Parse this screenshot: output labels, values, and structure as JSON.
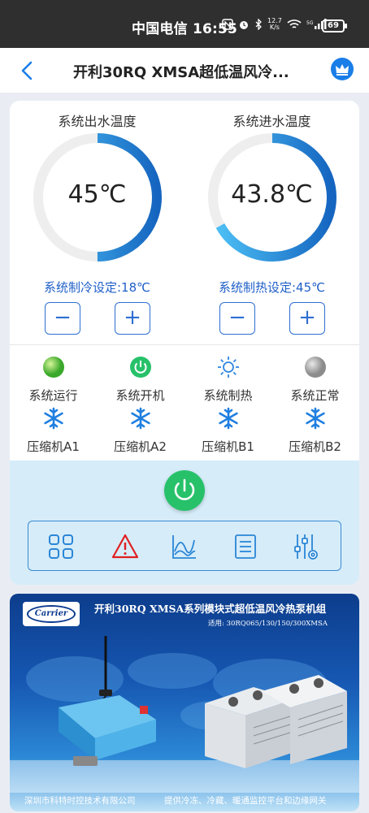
{
  "status_bar": {
    "carrier": "中国电信",
    "time": "16:55",
    "net_speed": "12.7",
    "net_unit": "K/s",
    "battery": "69"
  },
  "header": {
    "title": "开利30RQ XMSA超低温风冷..."
  },
  "gauges": [
    {
      "label": "系统出水温度",
      "value": "45℃",
      "fill": 0.5,
      "setting": "系统制冷设定:18℃",
      "minus": "−",
      "plus": "+"
    },
    {
      "label": "系统进水温度",
      "value": "43.8℃",
      "fill": 0.67,
      "setting": "系统制热设定:45℃",
      "minus": "−",
      "plus": "+"
    }
  ],
  "status_items": [
    {
      "label": "系统运行",
      "icon": "running-indicator-icon"
    },
    {
      "label": "系统开机",
      "icon": "power-on-icon"
    },
    {
      "label": "系统制热",
      "icon": "sun-icon"
    },
    {
      "label": "系统正常",
      "icon": "normal-indicator-icon"
    },
    {
      "label": "压缩机A1",
      "icon": "snowflake-icon"
    },
    {
      "label": "压缩机A2",
      "icon": "snowflake-icon"
    },
    {
      "label": "压缩机B1",
      "icon": "snowflake-icon"
    },
    {
      "label": "压缩机B2",
      "icon": "snowflake-icon"
    }
  ],
  "toolbar": [
    "grid-icon",
    "alarm-icon",
    "curve-chart-icon",
    "list-icon",
    "settings-sliders-icon"
  ],
  "banner": {
    "logo": "Carrier",
    "title": "开利30RQ XMSA系列模块式超低温风冷热泵机组",
    "subtitle": "适用: 30RQ065/130/150/300XMSA",
    "footer_left": "深圳市科特时控技术有限公司",
    "footer_right": "提供冷冻、冷藏、暖通监控平台和边缘网关"
  },
  "colors": {
    "accent": "#1a7ee8",
    "gauge_fill_start": "#1565c0",
    "gauge_fill_end": "#4fc3f7",
    "set_text": "#1f5fc8",
    "power_green": "#27c16a",
    "panel_bg": "#d6ecf9"
  }
}
